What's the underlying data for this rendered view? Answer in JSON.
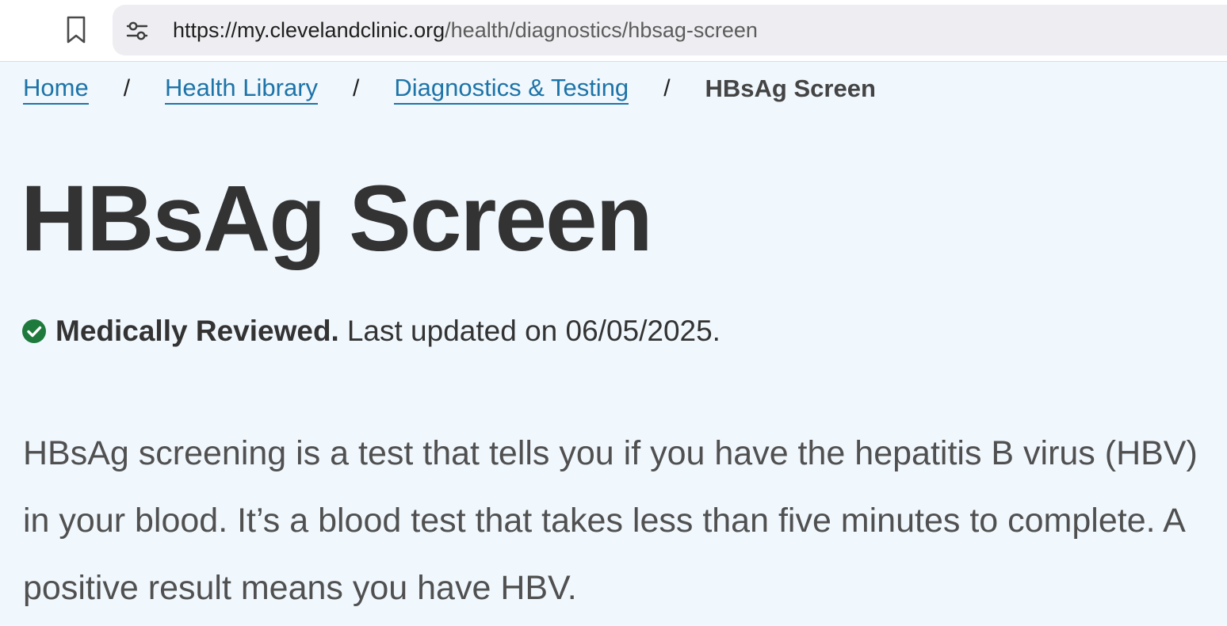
{
  "browser": {
    "url_host": "https://my.clevelandclinic.org",
    "url_path": "/health/diagnostics/hbsag-screen",
    "icons": {
      "bookmark": "bookmark-icon",
      "site_settings": "site-settings-icon"
    }
  },
  "breadcrumb": {
    "items": [
      {
        "label": "Home"
      },
      {
        "label": "Health Library"
      },
      {
        "label": "Diagnostics & Testing"
      }
    ],
    "separator": "/",
    "current": "HBsAg Screen"
  },
  "page": {
    "title": "HBsAg Screen",
    "review": {
      "icon": "check-circle-icon",
      "label": "Medically Reviewed.",
      "updated": "Last updated on 06/05/2025."
    },
    "intro": "HBsAg screening is a test that tells you if you have the hepatitis B virus (HBV) in your blood. It’s a blood test that takes less than five minutes to complete. A positive result means you have HBV."
  },
  "colors": {
    "link": "#1d74a8",
    "title": "#333333",
    "body_text": "#505050",
    "page_bg": "#f0f7fd",
    "review_check": "#1e7a3c"
  }
}
